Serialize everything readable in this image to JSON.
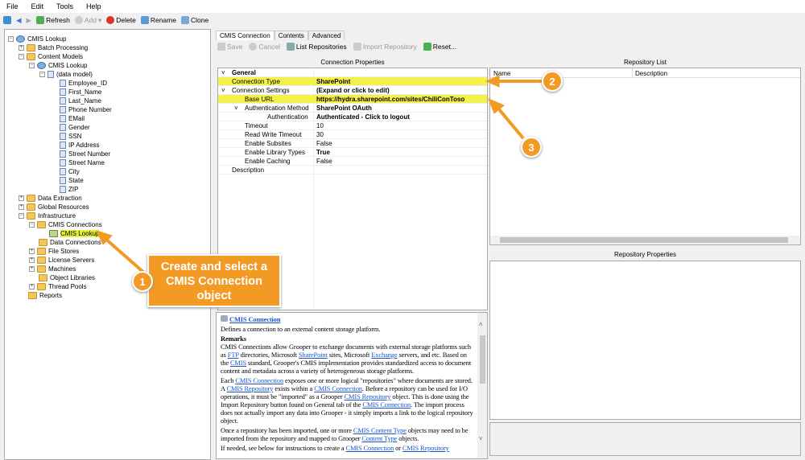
{
  "menu": [
    "File",
    "Edit",
    "Tools",
    "Help"
  ],
  "toolbar": {
    "refresh": "Refresh",
    "add": "Add",
    "delete": "Delete",
    "rename": "Rename",
    "clone": "Clone"
  },
  "tree": [
    {
      "label": "CMIS Lookup",
      "level": 0,
      "type": "root"
    },
    {
      "label": "Batch Processing",
      "level": 1,
      "type": "folder"
    },
    {
      "label": "Content Models",
      "level": 1,
      "type": "folder"
    },
    {
      "label": "CMIS Lookup",
      "level": 2,
      "type": "model"
    },
    {
      "label": "(data model)",
      "level": 3,
      "type": "doc"
    },
    {
      "label": "Employee_ID",
      "level": 4,
      "type": "field"
    },
    {
      "label": "First_Name",
      "level": 4,
      "type": "field"
    },
    {
      "label": "Last_Name",
      "level": 4,
      "type": "field"
    },
    {
      "label": "Phone Number",
      "level": 4,
      "type": "field"
    },
    {
      "label": "EMail",
      "level": 4,
      "type": "field"
    },
    {
      "label": "Gender",
      "level": 4,
      "type": "field"
    },
    {
      "label": "SSN",
      "level": 4,
      "type": "field"
    },
    {
      "label": "IP Address",
      "level": 4,
      "type": "field"
    },
    {
      "label": "Street Number",
      "level": 4,
      "type": "field"
    },
    {
      "label": "Street Name",
      "level": 4,
      "type": "field"
    },
    {
      "label": "City",
      "level": 4,
      "type": "field"
    },
    {
      "label": "State",
      "level": 4,
      "type": "field"
    },
    {
      "label": "ZIP",
      "level": 4,
      "type": "field"
    },
    {
      "label": "Data Extraction",
      "level": 1,
      "type": "folder"
    },
    {
      "label": "Global Resources",
      "level": 1,
      "type": "folder"
    },
    {
      "label": "Infrastructure",
      "level": 1,
      "type": "folder"
    },
    {
      "label": "CMIS Connections",
      "level": 2,
      "type": "folder"
    },
    {
      "label": "CMIS Lookup",
      "level": 3,
      "type": "conn",
      "selected": true
    },
    {
      "label": "Data Connections",
      "level": 2,
      "type": "folder"
    },
    {
      "label": "File Stores",
      "level": 2,
      "type": "folder"
    },
    {
      "label": "License Servers",
      "level": 2,
      "type": "folder"
    },
    {
      "label": "Machines",
      "level": 2,
      "type": "folder"
    },
    {
      "label": "Object Libraries",
      "level": 2,
      "type": "folder"
    },
    {
      "label": "Thread Pools",
      "level": 2,
      "type": "folder"
    },
    {
      "label": "Reports",
      "level": 1,
      "type": "folder"
    }
  ],
  "tabs": [
    "CMIS Connection",
    "Contents",
    "Advanced"
  ],
  "rtool": {
    "save": "Save",
    "cancel": "Cancel",
    "list": "List Repositories",
    "import": "Import Repository",
    "reset": "Reset..."
  },
  "conn_props_title": "Connection Properties",
  "props": [
    {
      "k": "General",
      "v": "",
      "indent": 0,
      "bold": true,
      "exp": true
    },
    {
      "k": "Connection Type",
      "v": "SharePoint",
      "indent": 0,
      "hl": true,
      "vb": true
    },
    {
      "k": "Connection Settings",
      "v": "(Expand or click to edit)",
      "indent": 0,
      "exp": true,
      "vb": true
    },
    {
      "k": "Base URL",
      "v": "https://hydra.sharepoint.com/sites/ChiliConToso",
      "indent": 1,
      "hl": true,
      "vb": true
    },
    {
      "k": "Authentication Method",
      "v": "SharePoint OAuth",
      "indent": 1,
      "exp": true,
      "vb": true
    },
    {
      "k": "Authentication",
      "v": "Authenticated - Click to logout",
      "indent": 2,
      "vb": true
    },
    {
      "k": "Timeout",
      "v": "10",
      "indent": 1
    },
    {
      "k": "Read Write Timeout",
      "v": "30",
      "indent": 1
    },
    {
      "k": "Enable Subsites",
      "v": "False",
      "indent": 1
    },
    {
      "k": "Enable Library Types",
      "v": "True",
      "indent": 1,
      "vb": true
    },
    {
      "k": "Enable Caching",
      "v": "False",
      "indent": 1
    },
    {
      "k": "Description",
      "v": "",
      "indent": 0
    }
  ],
  "repo_list_title": "Repository List",
  "repo_cols": [
    "Name",
    "Description"
  ],
  "repo_props_title": "Repository Properties",
  "help": {
    "title": "CMIS Connection",
    "summary": "Defines a connection to an external content storage platform.",
    "remarks": "Remarks",
    "p1a": "CMIS Connections allow Grooper to exchange documents with external storage platforms such as ",
    "ftp": "FTP",
    "p1b": " directories, Microsoft ",
    "sp": "SharePoint",
    "p1c": " sites, Microsoft ",
    "ex": "Exchange",
    "p1d": " servers, and etc. Based on the ",
    "cmis": "CMIS",
    "p1e": " standard, Grooper's CMIS implementation provides standardized access to document content and metadata across a variety of heterogeneous storage platforms.",
    "p2a": "Each ",
    "cc": "CMIS Connection",
    "p2b": " exposes one or more logical \"repositories\" where documents are stored. A ",
    "cr": "CMIS Repository",
    "p2c": " exists within a ",
    "p2d": ". Before a repository can be used for I/O operations, it must be \"imported\" as a Grooper ",
    "p2e": " object. This is done using the Import Repository button found on General tab of the ",
    "p2f": ". The import process does not actually import any data into Grooper - it simply imports a link to the logical repository object.",
    "p3a": "Once a repository has been imported, one or more ",
    "cct": "CMIS Content Type",
    "p3b": " objects may need to be imported from the repository and mapped to Grooper ",
    "ct": "Content Type",
    "p3c": " objects.",
    "p4a": "If needed, see below for instructions to create a ",
    "p4b": " or "
  },
  "callouts": {
    "c1": "Create and select a CMIS Connection object",
    "n1": "1",
    "n2": "2",
    "n3": "3"
  },
  "colors": {
    "accent": "#f29a24",
    "highlight": "#f2f24a"
  }
}
